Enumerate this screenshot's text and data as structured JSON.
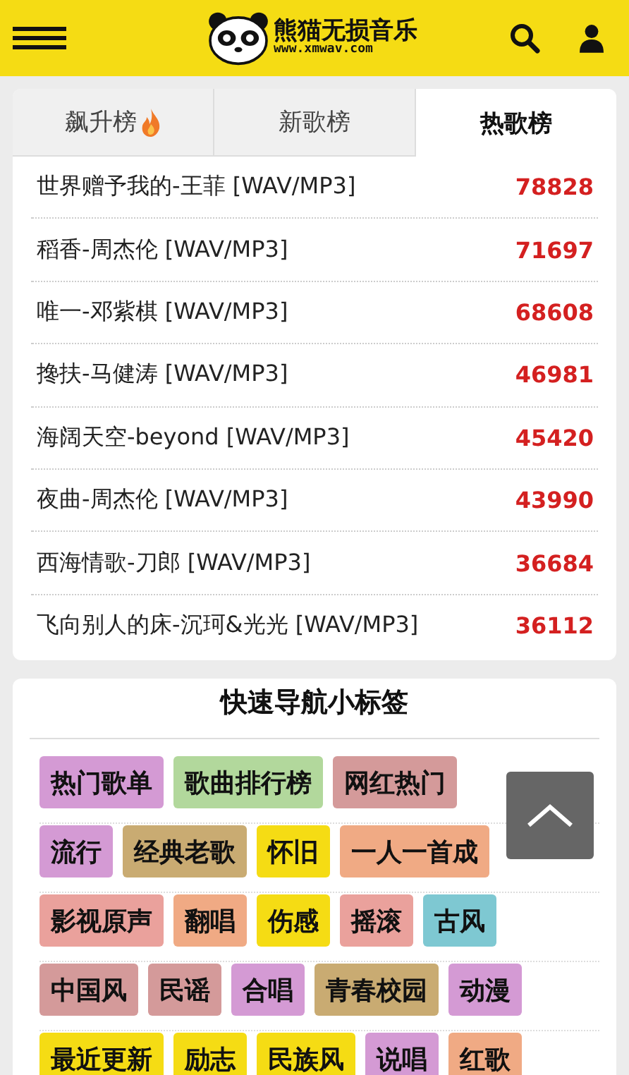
{
  "header": {
    "logo_title": "熊猫无损音乐",
    "logo_url": "www.xmwav.com"
  },
  "tabs": [
    {
      "label": "飙升榜",
      "hot": true,
      "selected": false
    },
    {
      "label": "新歌榜",
      "hot": false,
      "selected": false
    },
    {
      "label": "热歌榜",
      "hot": false,
      "selected": true
    }
  ],
  "songs": [
    {
      "title": "世界赠予我的-王菲 [WAV/MP3]",
      "count": "78828"
    },
    {
      "title": "稻香-周杰伦 [WAV/MP3]",
      "count": "71697"
    },
    {
      "title": "唯一-邓紫棋 [WAV/MP3]",
      "count": "68608"
    },
    {
      "title": "搀扶-马健涛 [WAV/MP3]",
      "count": "46981"
    },
    {
      "title": "海阔天空-beyond [WAV/MP3]",
      "count": "45420"
    },
    {
      "title": "夜曲-周杰伦 [WAV/MP3]",
      "count": "43990"
    },
    {
      "title": "西海情歌-刀郎 [WAV/MP3]",
      "count": "36684"
    },
    {
      "title": "飞向别人的床-沉珂&光光 [WAV/MP3]",
      "count": "36112"
    }
  ],
  "nav_section": {
    "title": "快速导航小标签",
    "tag_rows": [
      [
        {
          "label": "热门歌单",
          "color": "#d49ad4"
        },
        {
          "label": "歌曲排行榜",
          "color": "#b2d89c"
        },
        {
          "label": "网红热门",
          "color": "#d49a9a"
        }
      ],
      [
        {
          "label": "流行",
          "color": "#d49ad4"
        },
        {
          "label": "经典老歌",
          "color": "#c9ab72"
        },
        {
          "label": "怀旧",
          "color": "#f5dc14"
        },
        {
          "label": "一人一首成",
          "color": "#f0aa84"
        }
      ],
      [
        {
          "label": "影视原声",
          "color": "#eaa19c"
        },
        {
          "label": "翻唱",
          "color": "#f0aa84"
        },
        {
          "label": "伤感",
          "color": "#f5dc14"
        },
        {
          "label": "摇滚",
          "color": "#eaa19c"
        },
        {
          "label": "古风",
          "color": "#7ec8d2"
        }
      ],
      [
        {
          "label": "中国风",
          "color": "#d49a9a"
        },
        {
          "label": "民谣",
          "color": "#d49a9a"
        },
        {
          "label": "合唱",
          "color": "#d49ad4"
        },
        {
          "label": "青春校园",
          "color": "#c9ab72"
        },
        {
          "label": "动漫",
          "color": "#d49ad4"
        }
      ],
      [
        {
          "label": "最近更新",
          "color": "#f5dc14"
        },
        {
          "label": "励志",
          "color": "#f5dc14"
        },
        {
          "label": "民族风",
          "color": "#f5dc14"
        },
        {
          "label": "说唱",
          "color": "#d49ad4"
        },
        {
          "label": "红歌",
          "color": "#f0aa84"
        }
      ]
    ]
  }
}
